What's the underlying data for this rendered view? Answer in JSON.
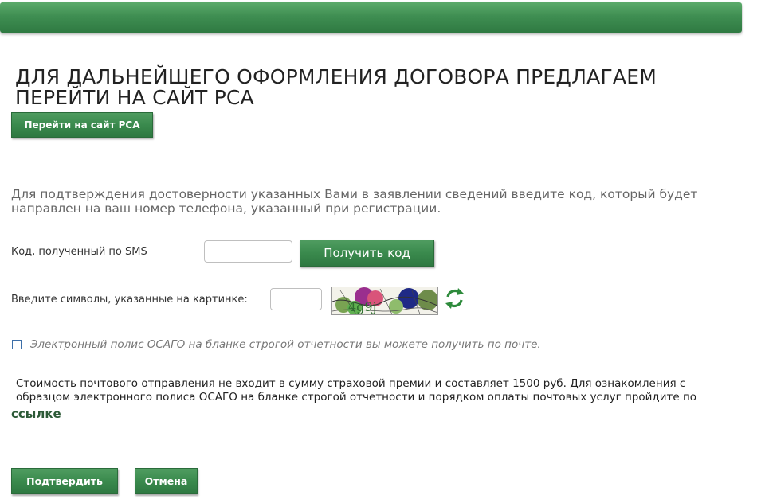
{
  "header": {
    "title": "ДЛЯ ДАЛЬНЕЙШЕГО ОФОРМЛЕНИЯ ДОГОВОРА ПРЕДЛАГАЕМ ПЕРЕЙТИ НА САЙТ РСА"
  },
  "buttons": {
    "go_rsa": "Перейти на сайт РСА",
    "get_code": "Получить код",
    "confirm": "Подтвердить",
    "cancel": "Отмена"
  },
  "info_text": "Для подтверждения достоверности указанных Вами в заявлении сведений введите код, который будет направлен на ваш номер телефона, указанный при регистрации.",
  "form": {
    "sms_label": "Код, полученный по SMS",
    "sms_value": "",
    "captcha_label": "Введите символы, указанные на картинке:",
    "captcha_value": "",
    "captcha_chars": "4g9j",
    "refresh_icon": "refresh-arrows-icon"
  },
  "checkbox": {
    "checked": false,
    "label": "Электронный полис ОСАГО на бланке строгой отчетности вы можете получить по почте."
  },
  "note": {
    "text": "Стоимость почтового отправления не входит в сумму страховой премии и составляет 1500 руб. Для ознакомления с образцом электронного полиса ОСАГО на бланке строгой отчетности и порядком оплаты почтовых услуг пройдите по",
    "link": "ссылке"
  },
  "colors": {
    "brand_green": "#3a8a4d",
    "link_green": "#2c5a37"
  }
}
